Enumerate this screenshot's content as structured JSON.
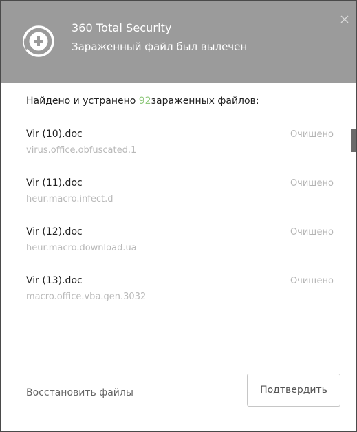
{
  "header": {
    "app_title": "360 Total Security",
    "subtitle": "Зараженный файл был вылечен",
    "logo_icon": "plus-shield-icon",
    "close_icon": "close-icon"
  },
  "summary": {
    "prefix": "Найдено и устранено ",
    "count": "92",
    "suffix": "зараженных файлов:"
  },
  "items": [
    {
      "file": "Vir (10).doc",
      "threat": "virus.office.obfuscated.1",
      "status": "Очищено"
    },
    {
      "file": "Vir (11).doc",
      "threat": "heur.macro.infect.d",
      "status": "Очищено"
    },
    {
      "file": "Vir (12).doc",
      "threat": "heur.macro.download.ua",
      "status": "Очищено"
    },
    {
      "file": "Vir (13).doc",
      "threat": "macro.office.vba.gen.3032",
      "status": "Очищено"
    }
  ],
  "footer": {
    "restore_label": "Восстановить файлы",
    "confirm_label": "Подтвердить"
  },
  "colors": {
    "header_bg": "#9b9b9b",
    "count_accent": "#8fc87c",
    "status_gray": "#b4b4b4"
  }
}
